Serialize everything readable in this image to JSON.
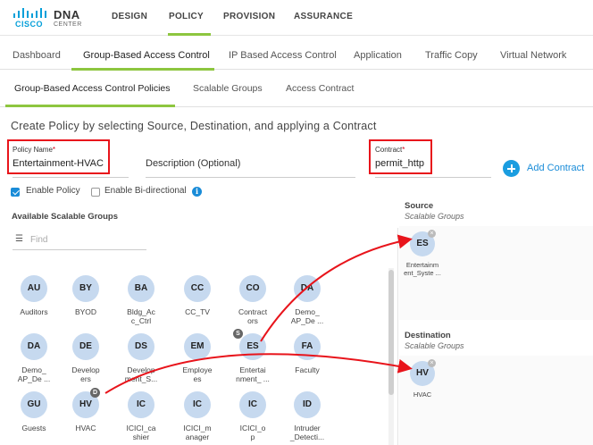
{
  "brand": {
    "cisco": "CISCO",
    "dna": "DNA",
    "center": "CENTER"
  },
  "topnav": [
    "DESIGN",
    "POLICY",
    "PROVISION",
    "ASSURANCE"
  ],
  "tabs": [
    "Dashboard",
    "Group-Based Access Control",
    "IP Based Access Control",
    "Application",
    "Traffic Copy",
    "Virtual Network"
  ],
  "subtabs": [
    "Group-Based Access Control Policies",
    "Scalable Groups",
    "Access Contract"
  ],
  "heading": "Create Policy by selecting Source, Destination, and applying a Contract",
  "form": {
    "policy_name_label": "Policy Name",
    "policy_name_value": "Entertainment-HVAC",
    "description_placeholder": "Description (Optional)",
    "contract_label": "Contract",
    "contract_value": "permit_http",
    "required_mark": "*",
    "add_contract": "Add Contract",
    "enable_policy": "Enable Policy",
    "enable_bidirectional": "Enable Bi-directional",
    "info": "i"
  },
  "available": {
    "title": "Available Scalable Groups",
    "find_placeholder": "Find",
    "groups": [
      {
        "abbr": "AU",
        "line1": "Auditors",
        "line2": ""
      },
      {
        "abbr": "BY",
        "line1": "BYOD",
        "line2": ""
      },
      {
        "abbr": "BA",
        "line1": "Bldg_Ac",
        "line2": "c_Ctrl"
      },
      {
        "abbr": "CC",
        "line1": "CC_TV",
        "line2": ""
      },
      {
        "abbr": "CO",
        "line1": "Contract",
        "line2": "ors"
      },
      {
        "abbr": "DA",
        "line1": "Demo_",
        "line2": "AP_De ..."
      },
      {
        "abbr": "DA",
        "line1": "Demo_",
        "line2": "AP_De ..."
      },
      {
        "abbr": "DE",
        "line1": "Develop",
        "line2": "ers"
      },
      {
        "abbr": "DS",
        "line1": "Develop",
        "line2": "ment_S..."
      },
      {
        "abbr": "EM",
        "line1": "Employe",
        "line2": "es"
      },
      {
        "abbr": "ES",
        "line1": "Entertai",
        "line2": "nment_ ...",
        "badge": "S"
      },
      {
        "abbr": "FA",
        "line1": "Faculty",
        "line2": ""
      },
      {
        "abbr": "GU",
        "line1": "Guests",
        "line2": ""
      },
      {
        "abbr": "HV",
        "line1": "HVAC",
        "line2": "",
        "badge": "D"
      },
      {
        "abbr": "IC",
        "line1": "ICICI_ca",
        "line2": "shier"
      },
      {
        "abbr": "IC",
        "line1": "ICICI_m",
        "line2": "anager"
      },
      {
        "abbr": "IC",
        "line1": "ICICI_o",
        "line2": "p"
      },
      {
        "abbr": "ID",
        "line1": "Intruder",
        "line2": "_Detecti..."
      }
    ]
  },
  "source": {
    "title": "Source",
    "subtitle": "Scalable Groups",
    "item": {
      "abbr": "ES",
      "line1": "Entertainm",
      "line2": "ent_Syste ..."
    }
  },
  "destination": {
    "title": "Destination",
    "subtitle": "Scalable Groups",
    "item": {
      "abbr": "HV",
      "line1": "HVAC",
      "line2": ""
    }
  },
  "colors": {
    "accent": "#8dc63f",
    "highlight": "#e8141b",
    "link": "#1a8cd8",
    "bubble": "#c6d9ef"
  }
}
